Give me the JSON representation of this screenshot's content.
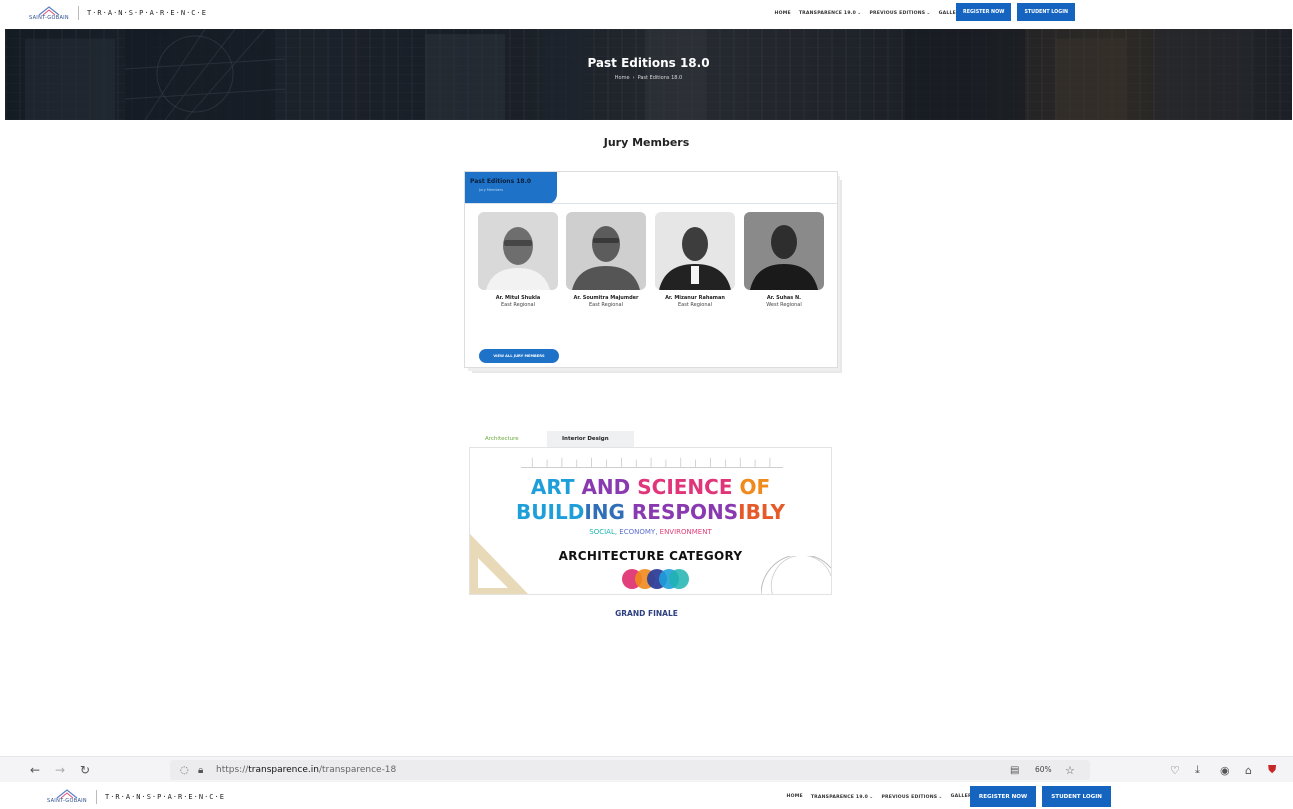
{
  "brand": {
    "saint_gobain": "SAINT-GOBAIN",
    "transparence_logo": "T·R·A·N·S·P·A·R·E·N·C·E"
  },
  "nav": {
    "home": "HOME",
    "transparence": "TRANSPARENCE 19.0",
    "previous": "PREVIOUS EDITIONS",
    "gallery": "GALLERY",
    "register": "REGISTER NOW",
    "student_login": "STUDENT LOGIN"
  },
  "hero": {
    "title": "Past Editions 18.0",
    "crumb_home": "Home",
    "crumb_current": "Past Editions 18.0"
  },
  "jury": {
    "section_title": "Jury Members",
    "tab_title": "Past Editions 18.0",
    "tab_subtitle": "Jury Members",
    "members": [
      {
        "name": "Ar. Mitul Shukla",
        "region": "East Regional"
      },
      {
        "name": "Ar. Soumitra Majumder",
        "region": "East Regional"
      },
      {
        "name": "Ar. Mizanur Rahaman",
        "region": "East Regional"
      },
      {
        "name": "Ar. Suhas N.",
        "region": "West Regional"
      }
    ],
    "view_all": "VIEW ALL JURY MEMBERS"
  },
  "categories": {
    "tabs": [
      "Architecture",
      "Interior Design"
    ],
    "active": "Architecture"
  },
  "banner": {
    "line1": [
      "ART",
      "AND",
      "SCIENCE",
      "OF"
    ],
    "line2": [
      "BUILD",
      "ING",
      "RESPONS",
      "IBLY"
    ],
    "sub": [
      "SOCIAL",
      "ECONOMY",
      "ENVIRONMENT"
    ],
    "category": "ARCHITECTURE CATEGORY"
  },
  "grand_finale": "GRAND FINALE",
  "browser": {
    "url_scheme": "https://",
    "url_host": "transparence.in",
    "url_path": "/transparence-18",
    "zoom": "60%"
  },
  "colors": {
    "primary_blue": "#1565c0",
    "tab_blue": "#1e73c8",
    "active_green": "#6aaa3a"
  }
}
